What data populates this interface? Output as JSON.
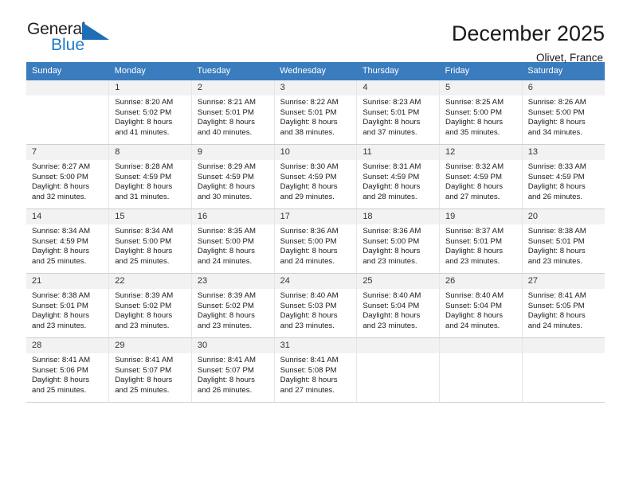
{
  "brand": {
    "name_part1": "General",
    "name_part2": "Blue",
    "flag_icon": "blue-triangle-flag-icon",
    "accent_color": "#1f7ac4"
  },
  "header": {
    "title": "December 2025",
    "location": "Olivet, France"
  },
  "calendar": {
    "header_bg": "#3a7cbe",
    "daynum_bg": "#f2f2f2",
    "weekday_headers": [
      "Sunday",
      "Monday",
      "Tuesday",
      "Wednesday",
      "Thursday",
      "Friday",
      "Saturday"
    ],
    "weeks": [
      [
        {
          "day": "",
          "sunrise": "",
          "sunset": "",
          "daylight_line1": "",
          "daylight_line2": ""
        },
        {
          "day": "1",
          "sunrise": "Sunrise: 8:20 AM",
          "sunset": "Sunset: 5:02 PM",
          "daylight_line1": "Daylight: 8 hours",
          "daylight_line2": "and 41 minutes."
        },
        {
          "day": "2",
          "sunrise": "Sunrise: 8:21 AM",
          "sunset": "Sunset: 5:01 PM",
          "daylight_line1": "Daylight: 8 hours",
          "daylight_line2": "and 40 minutes."
        },
        {
          "day": "3",
          "sunrise": "Sunrise: 8:22 AM",
          "sunset": "Sunset: 5:01 PM",
          "daylight_line1": "Daylight: 8 hours",
          "daylight_line2": "and 38 minutes."
        },
        {
          "day": "4",
          "sunrise": "Sunrise: 8:23 AM",
          "sunset": "Sunset: 5:01 PM",
          "daylight_line1": "Daylight: 8 hours",
          "daylight_line2": "and 37 minutes."
        },
        {
          "day": "5",
          "sunrise": "Sunrise: 8:25 AM",
          "sunset": "Sunset: 5:00 PM",
          "daylight_line1": "Daylight: 8 hours",
          "daylight_line2": "and 35 minutes."
        },
        {
          "day": "6",
          "sunrise": "Sunrise: 8:26 AM",
          "sunset": "Sunset: 5:00 PM",
          "daylight_line1": "Daylight: 8 hours",
          "daylight_line2": "and 34 minutes."
        }
      ],
      [
        {
          "day": "7",
          "sunrise": "Sunrise: 8:27 AM",
          "sunset": "Sunset: 5:00 PM",
          "daylight_line1": "Daylight: 8 hours",
          "daylight_line2": "and 32 minutes."
        },
        {
          "day": "8",
          "sunrise": "Sunrise: 8:28 AM",
          "sunset": "Sunset: 4:59 PM",
          "daylight_line1": "Daylight: 8 hours",
          "daylight_line2": "and 31 minutes."
        },
        {
          "day": "9",
          "sunrise": "Sunrise: 8:29 AM",
          "sunset": "Sunset: 4:59 PM",
          "daylight_line1": "Daylight: 8 hours",
          "daylight_line2": "and 30 minutes."
        },
        {
          "day": "10",
          "sunrise": "Sunrise: 8:30 AM",
          "sunset": "Sunset: 4:59 PM",
          "daylight_line1": "Daylight: 8 hours",
          "daylight_line2": "and 29 minutes."
        },
        {
          "day": "11",
          "sunrise": "Sunrise: 8:31 AM",
          "sunset": "Sunset: 4:59 PM",
          "daylight_line1": "Daylight: 8 hours",
          "daylight_line2": "and 28 minutes."
        },
        {
          "day": "12",
          "sunrise": "Sunrise: 8:32 AM",
          "sunset": "Sunset: 4:59 PM",
          "daylight_line1": "Daylight: 8 hours",
          "daylight_line2": "and 27 minutes."
        },
        {
          "day": "13",
          "sunrise": "Sunrise: 8:33 AM",
          "sunset": "Sunset: 4:59 PM",
          "daylight_line1": "Daylight: 8 hours",
          "daylight_line2": "and 26 minutes."
        }
      ],
      [
        {
          "day": "14",
          "sunrise": "Sunrise: 8:34 AM",
          "sunset": "Sunset: 4:59 PM",
          "daylight_line1": "Daylight: 8 hours",
          "daylight_line2": "and 25 minutes."
        },
        {
          "day": "15",
          "sunrise": "Sunrise: 8:34 AM",
          "sunset": "Sunset: 5:00 PM",
          "daylight_line1": "Daylight: 8 hours",
          "daylight_line2": "and 25 minutes."
        },
        {
          "day": "16",
          "sunrise": "Sunrise: 8:35 AM",
          "sunset": "Sunset: 5:00 PM",
          "daylight_line1": "Daylight: 8 hours",
          "daylight_line2": "and 24 minutes."
        },
        {
          "day": "17",
          "sunrise": "Sunrise: 8:36 AM",
          "sunset": "Sunset: 5:00 PM",
          "daylight_line1": "Daylight: 8 hours",
          "daylight_line2": "and 24 minutes."
        },
        {
          "day": "18",
          "sunrise": "Sunrise: 8:36 AM",
          "sunset": "Sunset: 5:00 PM",
          "daylight_line1": "Daylight: 8 hours",
          "daylight_line2": "and 23 minutes."
        },
        {
          "day": "19",
          "sunrise": "Sunrise: 8:37 AM",
          "sunset": "Sunset: 5:01 PM",
          "daylight_line1": "Daylight: 8 hours",
          "daylight_line2": "and 23 minutes."
        },
        {
          "day": "20",
          "sunrise": "Sunrise: 8:38 AM",
          "sunset": "Sunset: 5:01 PM",
          "daylight_line1": "Daylight: 8 hours",
          "daylight_line2": "and 23 minutes."
        }
      ],
      [
        {
          "day": "21",
          "sunrise": "Sunrise: 8:38 AM",
          "sunset": "Sunset: 5:01 PM",
          "daylight_line1": "Daylight: 8 hours",
          "daylight_line2": "and 23 minutes."
        },
        {
          "day": "22",
          "sunrise": "Sunrise: 8:39 AM",
          "sunset": "Sunset: 5:02 PM",
          "daylight_line1": "Daylight: 8 hours",
          "daylight_line2": "and 23 minutes."
        },
        {
          "day": "23",
          "sunrise": "Sunrise: 8:39 AM",
          "sunset": "Sunset: 5:02 PM",
          "daylight_line1": "Daylight: 8 hours",
          "daylight_line2": "and 23 minutes."
        },
        {
          "day": "24",
          "sunrise": "Sunrise: 8:40 AM",
          "sunset": "Sunset: 5:03 PM",
          "daylight_line1": "Daylight: 8 hours",
          "daylight_line2": "and 23 minutes."
        },
        {
          "day": "25",
          "sunrise": "Sunrise: 8:40 AM",
          "sunset": "Sunset: 5:04 PM",
          "daylight_line1": "Daylight: 8 hours",
          "daylight_line2": "and 23 minutes."
        },
        {
          "day": "26",
          "sunrise": "Sunrise: 8:40 AM",
          "sunset": "Sunset: 5:04 PM",
          "daylight_line1": "Daylight: 8 hours",
          "daylight_line2": "and 24 minutes."
        },
        {
          "day": "27",
          "sunrise": "Sunrise: 8:41 AM",
          "sunset": "Sunset: 5:05 PM",
          "daylight_line1": "Daylight: 8 hours",
          "daylight_line2": "and 24 minutes."
        }
      ],
      [
        {
          "day": "28",
          "sunrise": "Sunrise: 8:41 AM",
          "sunset": "Sunset: 5:06 PM",
          "daylight_line1": "Daylight: 8 hours",
          "daylight_line2": "and 25 minutes."
        },
        {
          "day": "29",
          "sunrise": "Sunrise: 8:41 AM",
          "sunset": "Sunset: 5:07 PM",
          "daylight_line1": "Daylight: 8 hours",
          "daylight_line2": "and 25 minutes."
        },
        {
          "day": "30",
          "sunrise": "Sunrise: 8:41 AM",
          "sunset": "Sunset: 5:07 PM",
          "daylight_line1": "Daylight: 8 hours",
          "daylight_line2": "and 26 minutes."
        },
        {
          "day": "31",
          "sunrise": "Sunrise: 8:41 AM",
          "sunset": "Sunset: 5:08 PM",
          "daylight_line1": "Daylight: 8 hours",
          "daylight_line2": "and 27 minutes."
        },
        {
          "day": "",
          "sunrise": "",
          "sunset": "",
          "daylight_line1": "",
          "daylight_line2": ""
        },
        {
          "day": "",
          "sunrise": "",
          "sunset": "",
          "daylight_line1": "",
          "daylight_line2": ""
        },
        {
          "day": "",
          "sunrise": "",
          "sunset": "",
          "daylight_line1": "",
          "daylight_line2": ""
        }
      ]
    ]
  }
}
